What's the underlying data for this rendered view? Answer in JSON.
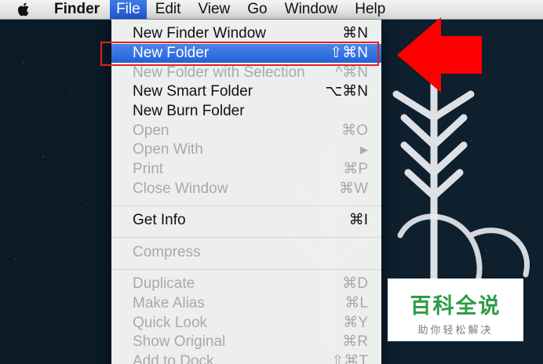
{
  "menubar": {
    "apple_icon": "apple-logo-icon",
    "items": [
      "Finder",
      "File",
      "Edit",
      "View",
      "Go",
      "Window",
      "Help"
    ],
    "active": "File"
  },
  "file_menu": {
    "items": [
      {
        "label": "New Finder Window",
        "shortcut": "⌘N",
        "state": "enabled"
      },
      {
        "label": "New Folder",
        "shortcut": "⇧⌘N",
        "state": "selected"
      },
      {
        "label": "New Folder with Selection",
        "shortcut": "^⌘N",
        "state": "disabled"
      },
      {
        "label": "New Smart Folder",
        "shortcut": "⌥⌘N",
        "state": "enabled"
      },
      {
        "label": "New Burn Folder",
        "shortcut": "",
        "state": "enabled"
      },
      {
        "label": "Open",
        "shortcut": "⌘O",
        "state": "disabled"
      },
      {
        "label": "Open With",
        "shortcut": "▶",
        "state": "disabled"
      },
      {
        "label": "Print",
        "shortcut": "⌘P",
        "state": "disabled"
      },
      {
        "label": "Close Window",
        "shortcut": "⌘W",
        "state": "disabled"
      },
      {
        "label": "Get Info",
        "shortcut": "⌘I",
        "state": "enabled"
      },
      {
        "label": "Compress",
        "shortcut": "",
        "state": "disabled"
      },
      {
        "label": "Duplicate",
        "shortcut": "⌘D",
        "state": "disabled"
      },
      {
        "label": "Make Alias",
        "shortcut": "⌘L",
        "state": "disabled"
      },
      {
        "label": "Quick Look",
        "shortcut": "⌘Y",
        "state": "disabled"
      },
      {
        "label": "Show Original",
        "shortcut": "⌘R",
        "state": "disabled"
      },
      {
        "label": "Add to Dock",
        "shortcut": "⇧⌘T",
        "state": "disabled"
      }
    ]
  },
  "annotation": {
    "highlight_color": "#e0221f",
    "arrow_color": "#ff0000",
    "arrow_icon": "left-arrow-icon"
  },
  "watermark": {
    "title": "百科全说",
    "subtitle": "助你轻松解决"
  },
  "colors": {
    "selection": "#2d6ae0",
    "desktop": "#0e1f2d",
    "watermark_green": "#2d9b46"
  }
}
